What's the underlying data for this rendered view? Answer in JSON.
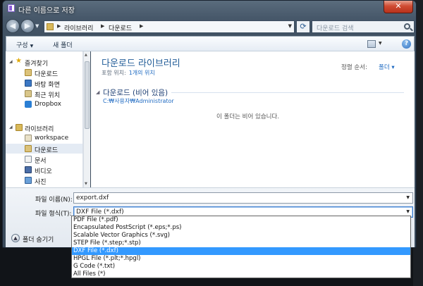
{
  "window": {
    "title": "다른 이름으로 저장",
    "close_label": "✕"
  },
  "navbar": {
    "breadcrumbs": [
      "라이브러리",
      "다운로드"
    ],
    "search_placeholder": "다운로드 검색"
  },
  "toolbar": {
    "organize_label": "구성",
    "new_folder_label": "새 폴더"
  },
  "nav_pane": {
    "favorites": [
      {
        "label": "즐겨찾기",
        "icon": "star-icon"
      },
      {
        "label": "다운로드",
        "icon": "download-folder-icon"
      },
      {
        "label": "바탕 화면",
        "icon": "desktop-icon"
      },
      {
        "label": "최근 위치",
        "icon": "recent-places-icon"
      },
      {
        "label": "Dropbox",
        "icon": "dropbox-icon"
      }
    ],
    "libraries": [
      {
        "label": "라이브러리",
        "icon": "library-icon"
      },
      {
        "label": "workspace",
        "icon": "workspace-icon"
      },
      {
        "label": "다운로드",
        "icon": "download-folder-icon",
        "selected": true
      },
      {
        "label": "문서",
        "icon": "documents-icon"
      },
      {
        "label": "비디오",
        "icon": "videos-icon"
      },
      {
        "label": "사진",
        "icon": "pictures-icon"
      }
    ]
  },
  "content": {
    "library_title": "다운로드 라이브러리",
    "includes_label": "포함 위치:",
    "includes_link": "1개의 위치",
    "sort_label": "정렬 순서:",
    "sort_value": "폴더 ▾",
    "group_header": "다운로드 (비어 있음)",
    "group_path": "C:₩사용자₩Administrator",
    "empty_message": "이 폴더는 비어 있습니다."
  },
  "bottom": {
    "filename_label": "파일 이름(N):",
    "filename_value": "export.dxf",
    "filetype_label": "파일 형식(T):",
    "filetype_value": "DXF File (*.dxf)",
    "hide_folders_label": "폴더 숨기기"
  },
  "filetype_options": [
    "PDF File (*.pdf)",
    "Encapsulated PostScript (*.eps;*.ps)",
    "Scalable Vector Graphics (*.svg)",
    "STEP File (*.step;*.stp)",
    "DXF File (*.dxf)",
    "HPGL File (*.plt;*.hpgl)",
    "G Code (*.txt)",
    "All Files (*)"
  ],
  "filetype_selected": "DXF File (*.dxf)",
  "colors": {
    "selection": "#3399ff",
    "title_blue": "#1e5a96",
    "link_blue": "#1e6ac2",
    "close_red": "#cf4b32"
  }
}
